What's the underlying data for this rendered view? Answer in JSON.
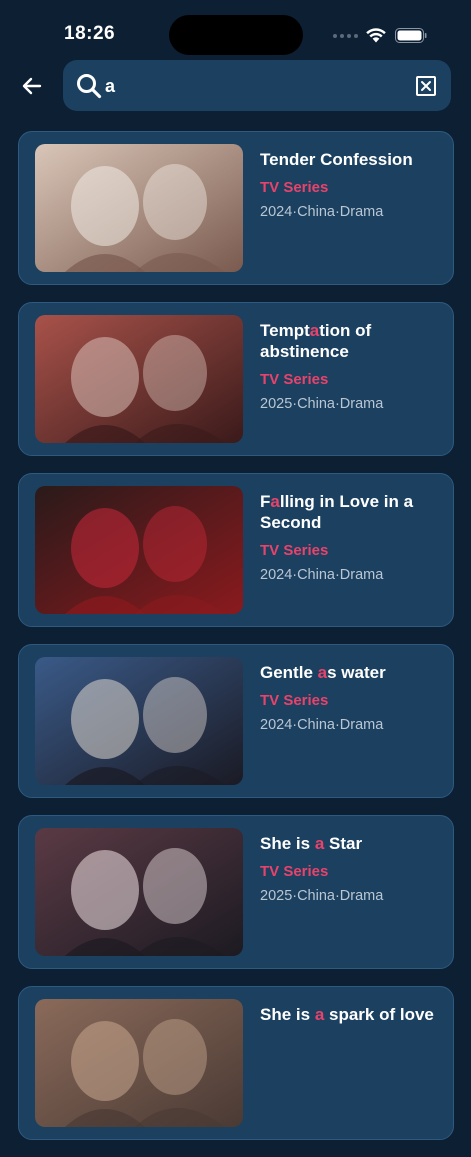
{
  "status_bar": {
    "time": "18:26"
  },
  "search": {
    "value": "a"
  },
  "results": [
    {
      "title_parts": [
        "Tender Confession",
        "",
        ""
      ],
      "category": "TV Series",
      "meta": "2024·China·Drama",
      "thumb": {
        "bg1": "#d9c6b8",
        "bg2": "#7a5a4e",
        "accent": "#f1ebe4"
      }
    },
    {
      "title_parts": [
        "Tempt",
        "a",
        "tion of abstinence"
      ],
      "category": "TV Series",
      "meta": "2025·China·Drama",
      "thumb": {
        "bg1": "#a8524a",
        "bg2": "#3a1a1a",
        "accent": "#d8c0b8"
      }
    },
    {
      "title_parts": [
        "F",
        "a",
        "lling in Love in a Second"
      ],
      "category": "TV Series",
      "meta": "2024·China·Drama",
      "thumb": {
        "bg1": "#2a1a1a",
        "bg2": "#8a1a1e",
        "accent": "#c8283a"
      }
    },
    {
      "title_parts": [
        "Gentle ",
        "a",
        "s water"
      ],
      "category": "TV Series",
      "meta": "2024·China·Drama",
      "thumb": {
        "bg1": "#3a5a88",
        "bg2": "#1a1a24",
        "accent": "#e0d8d0"
      }
    },
    {
      "title_parts": [
        "She is ",
        "a",
        " Star"
      ],
      "category": "TV Series",
      "meta": "2025·China·Drama",
      "thumb": {
        "bg1": "#5a3a44",
        "bg2": "#1c1a22",
        "accent": "#f0e4e6"
      }
    },
    {
      "title_parts": [
        "She is ",
        "a",
        " spark of love"
      ],
      "category": "",
      "meta": "",
      "thumb": {
        "bg1": "#8a6a5a",
        "bg2": "#4a3a34",
        "accent": "#c8a890"
      }
    }
  ]
}
